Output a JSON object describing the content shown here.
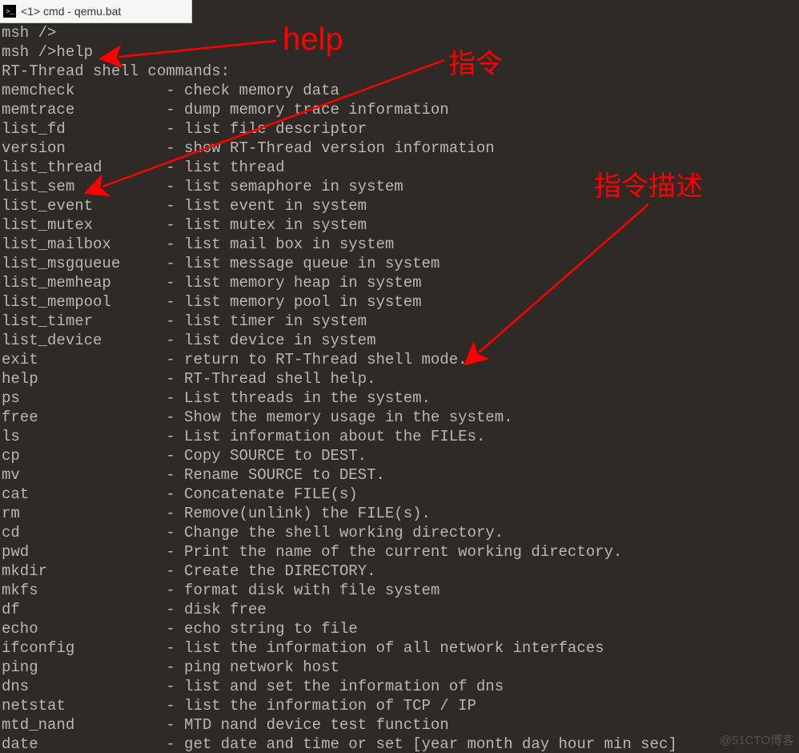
{
  "title": "<1> cmd - qemu.bat",
  "prompt_empty": "msh />",
  "prompt_help": "msh />help",
  "commands_header": "RT-Thread shell commands:",
  "separator": " - ",
  "annotations": {
    "help": "help",
    "command_label": "指令",
    "description_label": "指令描述"
  },
  "watermark": "@51CTO博客",
  "commands": [
    {
      "cmd": "memcheck",
      "desc": "check memory data"
    },
    {
      "cmd": "memtrace",
      "desc": "dump memory trace information"
    },
    {
      "cmd": "list_fd",
      "desc": "list file descriptor"
    },
    {
      "cmd": "version",
      "desc": "show RT-Thread version information"
    },
    {
      "cmd": "list_thread",
      "desc": "list thread"
    },
    {
      "cmd": "list_sem",
      "desc": "list semaphore in system"
    },
    {
      "cmd": "list_event",
      "desc": "list event in system"
    },
    {
      "cmd": "list_mutex",
      "desc": "list mutex in system"
    },
    {
      "cmd": "list_mailbox",
      "desc": "list mail box in system"
    },
    {
      "cmd": "list_msgqueue",
      "desc": "list message queue in system"
    },
    {
      "cmd": "list_memheap",
      "desc": "list memory heap in system"
    },
    {
      "cmd": "list_mempool",
      "desc": "list memory pool in system"
    },
    {
      "cmd": "list_timer",
      "desc": "list timer in system"
    },
    {
      "cmd": "list_device",
      "desc": "list device in system"
    },
    {
      "cmd": "exit",
      "desc": "return to RT-Thread shell mode."
    },
    {
      "cmd": "help",
      "desc": "RT-Thread shell help."
    },
    {
      "cmd": "ps",
      "desc": "List threads in the system."
    },
    {
      "cmd": "free",
      "desc": "Show the memory usage in the system."
    },
    {
      "cmd": "ls",
      "desc": "List information about the FILEs."
    },
    {
      "cmd": "cp",
      "desc": "Copy SOURCE to DEST."
    },
    {
      "cmd": "mv",
      "desc": "Rename SOURCE to DEST."
    },
    {
      "cmd": "cat",
      "desc": "Concatenate FILE(s)"
    },
    {
      "cmd": "rm",
      "desc": "Remove(unlink) the FILE(s)."
    },
    {
      "cmd": "cd",
      "desc": "Change the shell working directory."
    },
    {
      "cmd": "pwd",
      "desc": "Print the name of the current working directory."
    },
    {
      "cmd": "mkdir",
      "desc": "Create the DIRECTORY."
    },
    {
      "cmd": "mkfs",
      "desc": "format disk with file system"
    },
    {
      "cmd": "df",
      "desc": "disk free"
    },
    {
      "cmd": "echo",
      "desc": "echo string to file"
    },
    {
      "cmd": "ifconfig",
      "desc": "list the information of all network interfaces"
    },
    {
      "cmd": "ping",
      "desc": "ping network host"
    },
    {
      "cmd": "dns",
      "desc": "list and set the information of dns"
    },
    {
      "cmd": "netstat",
      "desc": "list the information of TCP / IP"
    },
    {
      "cmd": "mtd_nand",
      "desc": "MTD nand device test function"
    },
    {
      "cmd": "date",
      "desc": "get date and time or set [year month day hour min sec]"
    }
  ]
}
